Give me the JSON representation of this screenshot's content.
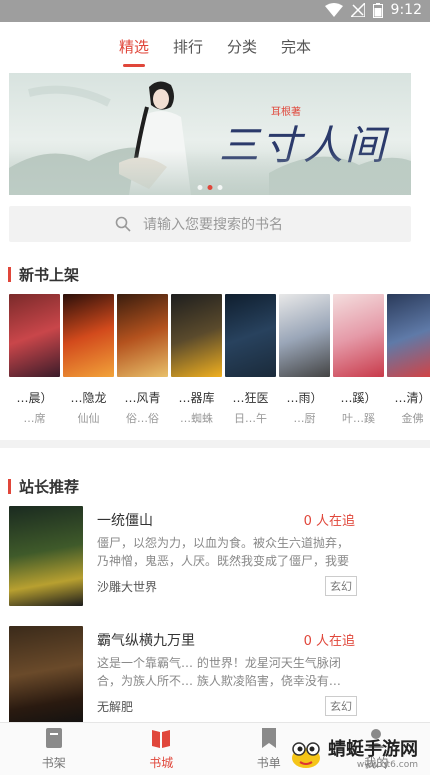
{
  "status_bar": {
    "time": "9:12"
  },
  "top_tabs": [
    {
      "label": "精选",
      "active": true
    },
    {
      "label": "排行",
      "active": false
    },
    {
      "label": "分类",
      "active": false
    },
    {
      "label": "完本",
      "active": false
    }
  ],
  "banner": {
    "title": "三寸人间",
    "author_tag": "耳根著"
  },
  "search": {
    "placeholder": "请输入您要搜索的书名"
  },
  "new_books": {
    "heading": "新书上架",
    "items": [
      {
        "title": "…晨）",
        "author": "…席"
      },
      {
        "title": "…隐龙",
        "author": "仙仙"
      },
      {
        "title": "…风青",
        "author": "俗…俗"
      },
      {
        "title": "…器库",
        "author": "…蜘蛛"
      },
      {
        "title": "…狂医",
        "author": "日…午"
      },
      {
        "title": "…雨）",
        "author": "…厨"
      },
      {
        "title": "…蹊）",
        "author": "叶…蹊"
      },
      {
        "title": "…清）",
        "author": "金佛"
      }
    ]
  },
  "recommend": {
    "heading": "站长推荐",
    "items": [
      {
        "title": "一统僵山",
        "readers": "0 人在追",
        "desc": "僵尸，以怨为力，以血为食。被众生六道抛弃，乃神憎，鬼恶，人厌。既然我变成了僵尸，我要成…",
        "author": "沙雕大世界",
        "tag": "玄幻"
      },
      {
        "title": "霸气纵横九万里",
        "readers": "0 人在追",
        "desc": "这是一个靠霸气… 的世界！龙星河天生气脉闭合，为族人所不… 族人欺凌陷害，侥幸没有…",
        "author": "无解肥",
        "tag": "玄幻"
      }
    ]
  },
  "bottom_nav": [
    {
      "label": "书架",
      "active": false
    },
    {
      "label": "书城",
      "active": true
    },
    {
      "label": "书单",
      "active": false
    },
    {
      "label": "我的",
      "active": false
    }
  ],
  "watermark": {
    "name": "蜻蜓手游网",
    "url": "www.qt6.com"
  },
  "colors": {
    "accent": "#e0463a",
    "status_bar": "#9e9e9e"
  }
}
